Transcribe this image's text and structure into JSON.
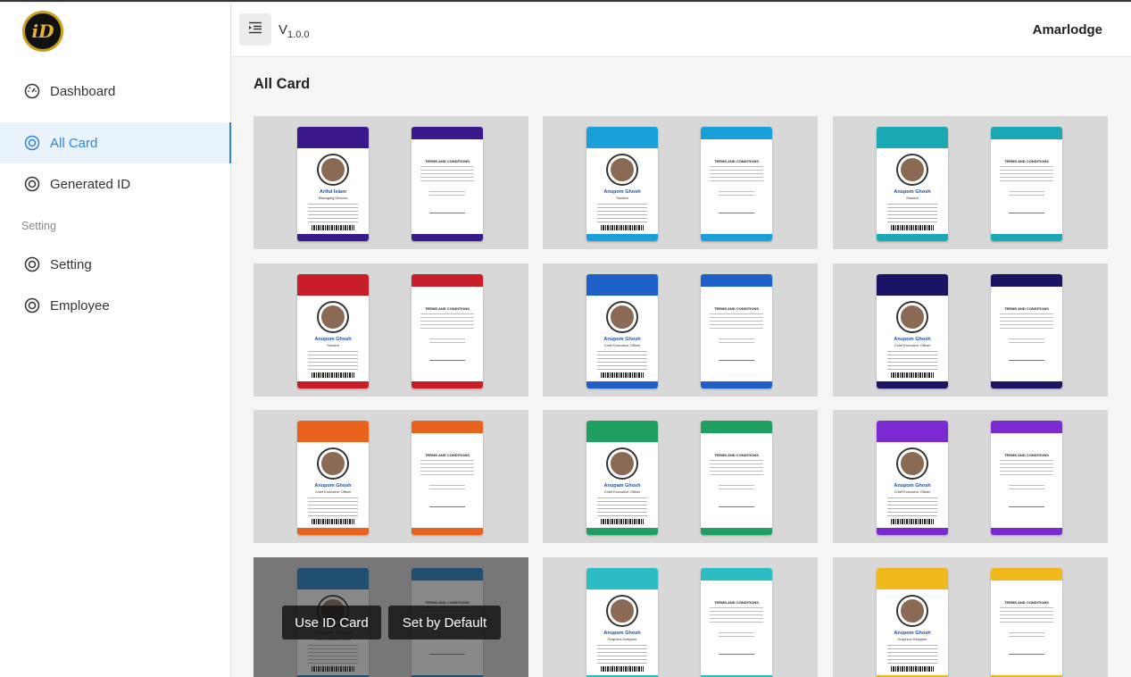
{
  "brand": {
    "logo_text": "iD"
  },
  "sidebar": {
    "items": [
      {
        "label": "Dashboard",
        "icon": "dashboard-icon",
        "active": false
      },
      {
        "label": "All Card",
        "icon": "card-icon",
        "active": true
      },
      {
        "label": "Generated ID",
        "icon": "id-icon",
        "active": false
      }
    ],
    "section_label": "Setting",
    "setting_items": [
      {
        "label": "Setting",
        "icon": "gear-icon"
      },
      {
        "label": "Employee",
        "icon": "user-icon"
      }
    ]
  },
  "header": {
    "version_prefix": "V",
    "version_number": "1.0.0",
    "username": "Amarlodge"
  },
  "main": {
    "title": "All Card",
    "overlay": {
      "use_label": "Use ID Card",
      "default_label": "Set by Default"
    },
    "templates": [
      {
        "accent": "#3a1a8a",
        "front_name": "Ariful Islam",
        "front_role": "Managing Director",
        "back_title": "TERMS AND CONDITIONS"
      },
      {
        "accent": "#1aa0d8",
        "front_name": "Anupom Ghosh",
        "front_role": "Student",
        "back_title": "TERMS AND CONDITIONS"
      },
      {
        "accent": "#1aa8b5",
        "front_name": "Anupom Ghosh",
        "front_role": "Student",
        "back_title": "TERMS AND CONDITIONS"
      },
      {
        "accent": "#c81e2a",
        "front_name": "Anupom Ghosh",
        "front_role": "Student",
        "back_title": "TERMS AND CONDITIONS"
      },
      {
        "accent": "#1f5fc8",
        "front_name": "Anupom Ghosh",
        "front_role": "Chief Executive Officer",
        "back_title": "TERMS AND CONDITIONS"
      },
      {
        "accent": "#1b1464",
        "front_name": "Anupom Ghosh",
        "front_role": "Chief Executive Officer",
        "back_title": "TERMS AND CONDITIONS"
      },
      {
        "accent": "#e8621c",
        "front_name": "Anupom Ghosh",
        "front_role": "Chief Executive Officer",
        "back_title": "TERMS AND CONDITIONS"
      },
      {
        "accent": "#20a060",
        "front_name": "Anupam Ghosh",
        "front_role": "Chief Executive Officer",
        "back_title": "TERMS AND CONDITIONS"
      },
      {
        "accent": "#7a2ad0",
        "front_name": "Anupom Ghosh",
        "front_role": "Chief Executive Officer",
        "back_title": "TERMS AND CONDITIONS"
      },
      {
        "accent": "#1a7ec8",
        "front_name": "Anupom Ghosh",
        "front_role": "Chief Executive Officer",
        "back_title": "TERMS AND CONDITIONS"
      },
      {
        "accent": "#2bbcc4",
        "front_name": "Anupom Ghosh",
        "front_role": "Graphics Designer",
        "back_title": "TERMS AND CONDITIONS"
      },
      {
        "accent": "#f2b91c",
        "front_name": "Anupom Ghosh",
        "front_role": "Graphics Designer",
        "back_title": "TERMS AND CONDITIONS"
      }
    ]
  }
}
